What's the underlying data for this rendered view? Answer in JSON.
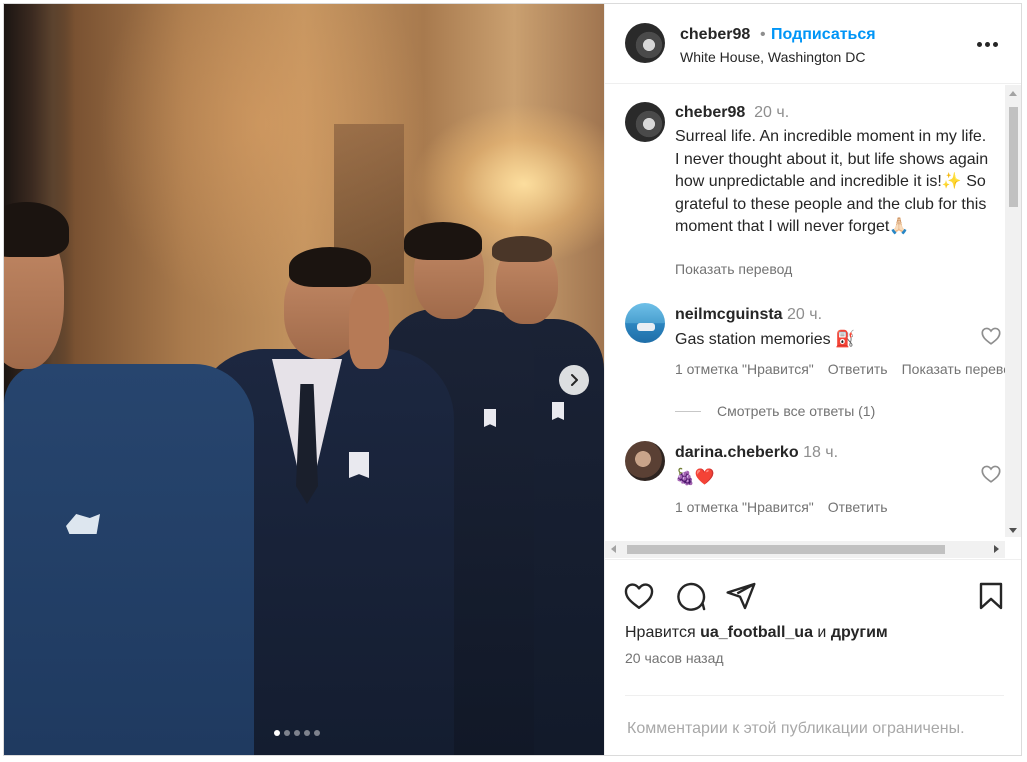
{
  "post": {
    "username": "cheber98",
    "separator": "•",
    "follow_label": "Подписаться",
    "location": "White House, Washington DC",
    "more_label": "Ещё"
  },
  "photo": {
    "carousel_count": 5,
    "active_index": 0
  },
  "caption": {
    "username": "cheber98",
    "time": "20 ч.",
    "text": "Surreal life. An incredible moment in my life. I never thought about it, but life shows again how unpredictable and incredible it is!✨ So grateful to these people and the club for this moment that I will never forget🙏🏻",
    "translate_label": "Показать перевод"
  },
  "comments": [
    {
      "username": "neilmcguinsta",
      "time": "20 ч.",
      "text": "Gas station memories ⛽",
      "likes_label": "1 отметка \"Нравится\"",
      "reply_label": "Ответить",
      "translate_label": "Показать перевод"
    },
    {
      "username": "darina.cheberko",
      "time": "18 ч.",
      "text": "🍇❤️",
      "likes_label": "1 отметка \"Нравится\"",
      "reply_label": "Ответить"
    }
  ],
  "replies_label": "Смотреть все ответы (1)",
  "likes": {
    "prefix": "Нравится",
    "user": "ua_football_ua",
    "connector": "и",
    "others": "другим"
  },
  "posted_time": "20 часов назад",
  "comments_limited": "Комментарии к этой публикации ограничены.",
  "colors": {
    "accent": "#0095f6",
    "text": "#262626",
    "secondary": "#737373",
    "border": "#dbdbdb",
    "heart_red": "#ed4956"
  },
  "icons": [
    "chevron-right-icon",
    "more-horizontal-icon",
    "heart-icon",
    "comment-icon",
    "share-icon",
    "bookmark-icon"
  ]
}
